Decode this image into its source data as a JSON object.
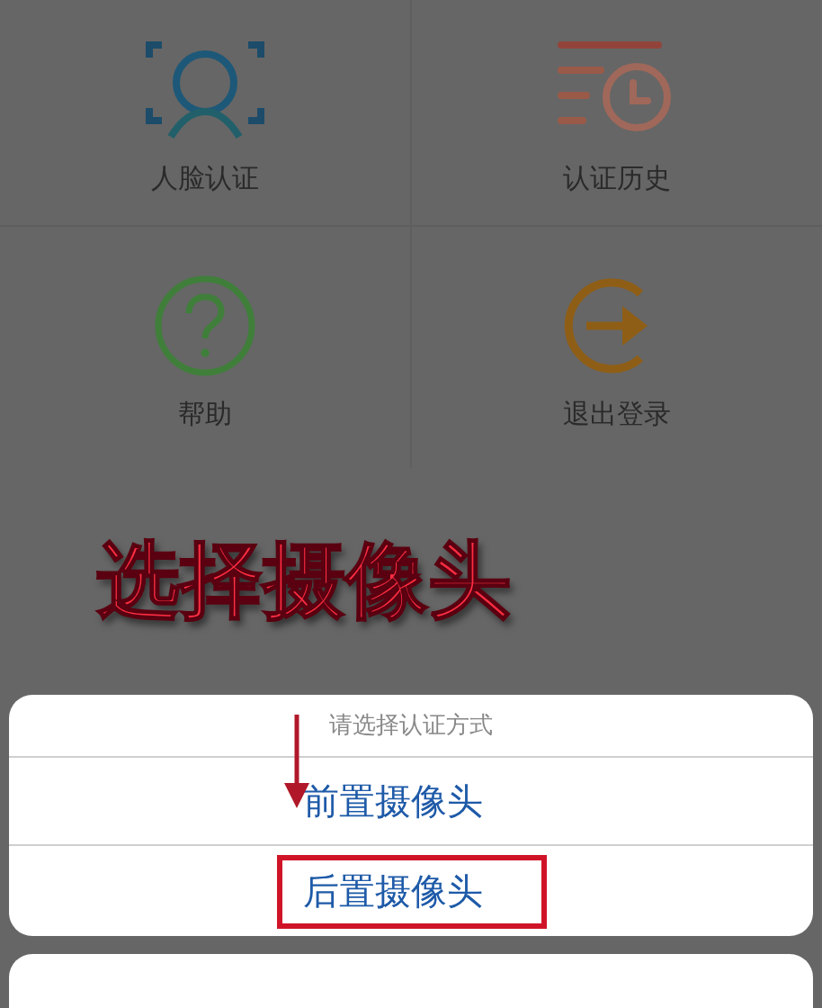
{
  "menu": [
    {
      "label": "人脸认证",
      "kind": "face"
    },
    {
      "label": "认证历史",
      "kind": "history"
    },
    {
      "label": "帮助",
      "kind": "help"
    },
    {
      "label": "退出登录",
      "kind": "logout"
    }
  ],
  "annotation": {
    "title": "选择摄像头"
  },
  "action_sheet": {
    "title": "请选择认证方式",
    "options": [
      {
        "label": "前置摄像头",
        "pointed": true,
        "highlighted": false
      },
      {
        "label": "后置摄像头",
        "pointed": false,
        "highlighted": true
      }
    ]
  }
}
